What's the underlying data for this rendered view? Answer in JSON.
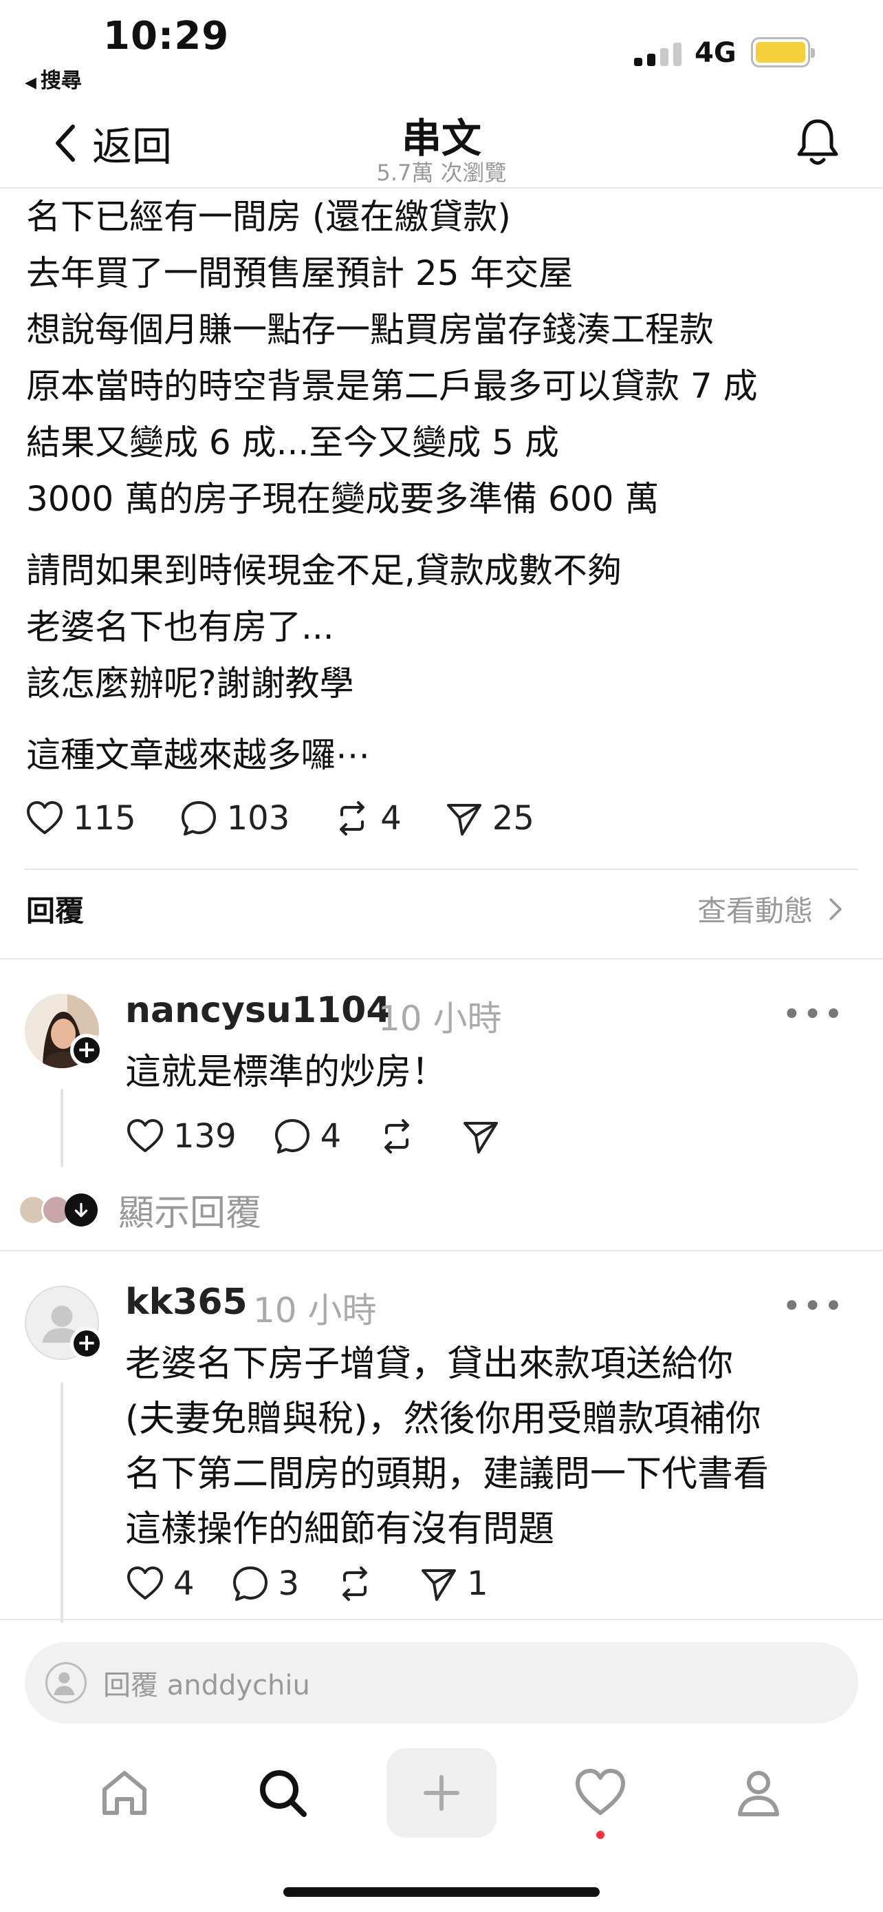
{
  "status_bar": {
    "time": "10:29",
    "back_label": "搜尋",
    "network": "4G",
    "battery_level": 1.0,
    "battery_color": "#f3cf3b"
  },
  "nav": {
    "back_label": "返回",
    "title": "串文",
    "subtitle": "5.7萬 次瀏覽"
  },
  "post": {
    "paragraphs": [
      [
        "名下已經有一間房 (還在繳貸款)",
        "去年買了一間預售屋預計 25 年交屋",
        "想說每個月賺一點存一點買房當存錢湊工程款",
        "原本當時的時空背景是第二戶最多可以貸款 7 成",
        "結果又變成 6 成...至今又變成 5 成",
        "3000 萬的房子現在變成要多準備 600 萬"
      ],
      [
        "請問如果到時候現金不足,貸款成數不夠",
        "老婆名下也有房了...",
        "該怎麼辦呢?謝謝教學"
      ],
      [
        "這種文章越來越多囉⋯"
      ]
    ],
    "likes": "115",
    "comments": "103",
    "reposts": "4",
    "shares": "25"
  },
  "replies_section": {
    "header": "回覆",
    "activity_label": "查看動態"
  },
  "comments": [
    {
      "username": "nancysu1104",
      "time": "10 小時",
      "text": [
        "這就是標準的炒房！"
      ],
      "likes": "139",
      "replies": "4",
      "reposts": "",
      "shares": ""
    },
    {
      "username": "kk365",
      "time": "10 小時",
      "text": [
        "老婆名下房子增貸，貸出來款項送給你",
        "(夫妻免贈與稅)，然後你用受贈款項補你",
        "名下第二間房的頭期，建議問一下代書看",
        "這樣操作的細節有沒有問題"
      ],
      "likes": "4",
      "replies": "3",
      "reposts": "",
      "shares": "1"
    }
  ],
  "show_replies_label": "顯示回覆",
  "reply_input": {
    "placeholder": "回覆 anddychiu"
  },
  "tabbar": {
    "icons": [
      "home-icon",
      "search-icon",
      "plus-icon",
      "heart-icon",
      "profile-icon"
    ],
    "notification_dot_color": "#ff3040"
  }
}
